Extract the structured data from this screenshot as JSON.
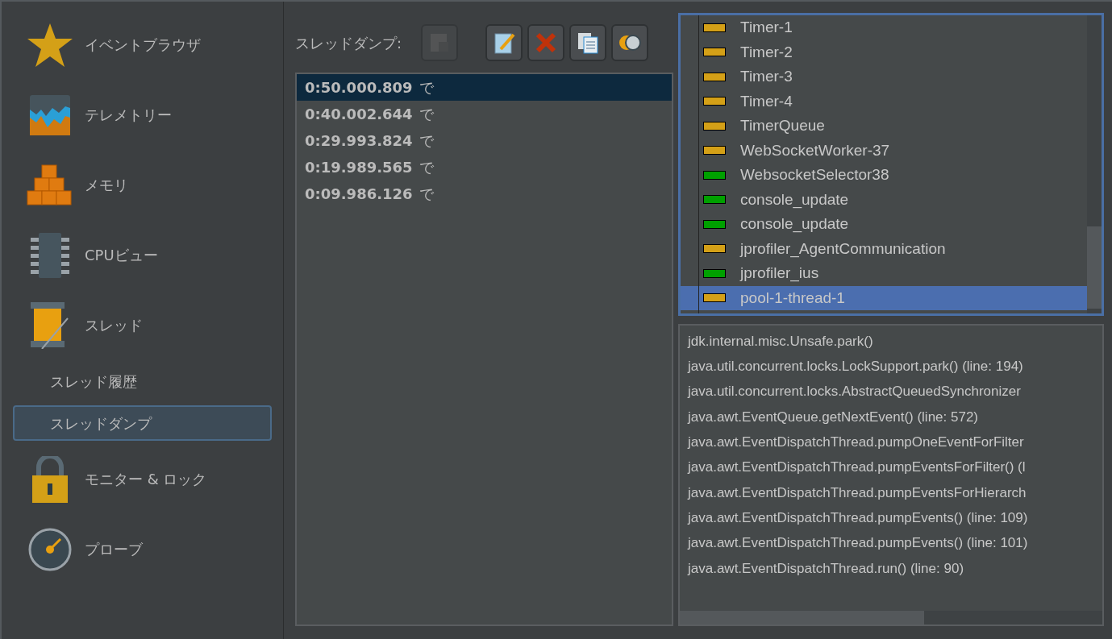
{
  "sidebar": {
    "items": [
      {
        "kind": "main",
        "label": "イベントブラウザ",
        "selected": false
      },
      {
        "kind": "main",
        "label": "テレメトリー",
        "selected": false
      },
      {
        "kind": "main",
        "label": "メモリ",
        "selected": false
      },
      {
        "kind": "main",
        "label": "CPUビュー",
        "selected": false
      },
      {
        "kind": "main",
        "label": "スレッド",
        "selected": false
      },
      {
        "kind": "sub",
        "label": "スレッド履歴",
        "selected": false
      },
      {
        "kind": "sub",
        "label": "スレッドダンプ",
        "selected": true
      },
      {
        "kind": "main",
        "label": "モニター & ロック",
        "selected": false
      },
      {
        "kind": "main",
        "label": "プローブ",
        "selected": false
      }
    ]
  },
  "toolbar": {
    "label": "スレッドダンプ:",
    "buttons": [
      {
        "disabled": true
      },
      {
        "disabled": false
      },
      {
        "disabled": false
      },
      {
        "disabled": false
      },
      {
        "disabled": false
      }
    ]
  },
  "dumps": [
    {
      "time": "0:50.000.809",
      "suffix": "で",
      "selected": true
    },
    {
      "time": "0:40.002.644",
      "suffix": "で",
      "selected": false
    },
    {
      "time": "0:29.993.824",
      "suffix": "で",
      "selected": false
    },
    {
      "time": "0:19.989.565",
      "suffix": "で",
      "selected": false
    },
    {
      "time": "0:09.986.126",
      "suffix": "で",
      "selected": false
    }
  ],
  "threads": [
    {
      "name": "Timer-1",
      "color": "#d4a017",
      "selected": false
    },
    {
      "name": "Timer-2",
      "color": "#d4a017",
      "selected": false
    },
    {
      "name": "Timer-3",
      "color": "#d4a017",
      "selected": false
    },
    {
      "name": "Timer-4",
      "color": "#d4a017",
      "selected": false
    },
    {
      "name": "TimerQueue",
      "color": "#d4a017",
      "selected": false
    },
    {
      "name": "WebSocketWorker-37",
      "color": "#d4a017",
      "selected": false
    },
    {
      "name": "WebsocketSelector38",
      "color": "#00a000",
      "selected": false
    },
    {
      "name": "console_update",
      "color": "#00a000",
      "selected": false
    },
    {
      "name": "console_update",
      "color": "#00a000",
      "selected": false
    },
    {
      "name": "jprofiler_AgentCommunication",
      "color": "#d4a017",
      "selected": false
    },
    {
      "name": "jprofiler_ius",
      "color": "#00a000",
      "selected": false
    },
    {
      "name": "pool-1-thread-1",
      "color": "#d4a017",
      "selected": true
    }
  ],
  "stack_trace": [
    "jdk.internal.misc.Unsafe.park()",
    "java.util.concurrent.locks.LockSupport.park() (line: 194)",
    "java.util.concurrent.locks.AbstractQueuedSynchronizer",
    "java.awt.EventQueue.getNextEvent() (line: 572)",
    "java.awt.EventDispatchThread.pumpOneEventForFilter",
    "java.awt.EventDispatchThread.pumpEventsForFilter() (l",
    "java.awt.EventDispatchThread.pumpEventsForHierarch",
    "java.awt.EventDispatchThread.pumpEvents() (line: 109)",
    "java.awt.EventDispatchThread.pumpEvents() (line: 101)",
    "java.awt.EventDispatchThread.run() (line: 90)"
  ]
}
